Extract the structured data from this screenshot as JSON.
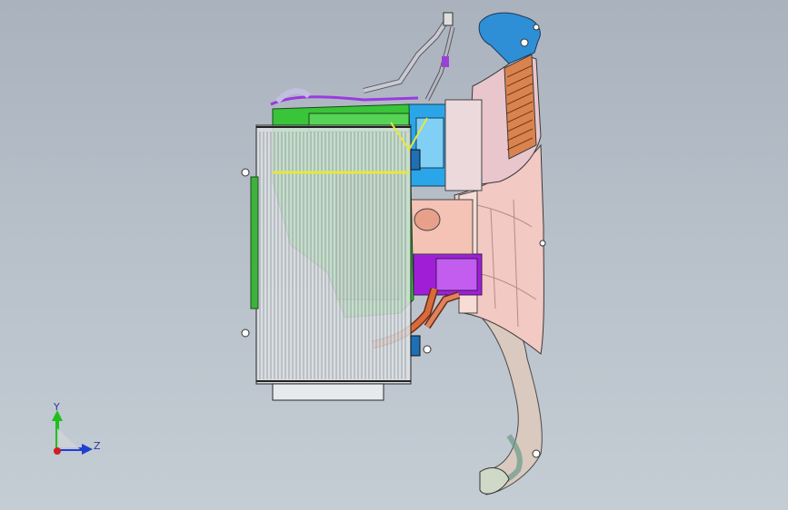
{
  "viewport": {
    "background_top": "#a9b2bd",
    "background_bottom": "#c4ccd4",
    "model": {
      "condenser_frame_color": "#dfe3e6",
      "condenser_fin_color": "#aab0b6",
      "engine_green": "#39c43a",
      "fan_shroud_pink": "#f2c9c3",
      "duct_pink": "#e9c6cc",
      "air_box_blue": "#2aa6e8",
      "purple_bracket": "#a01fd6",
      "hose_gray": "#b9b9c8",
      "intake_orange": "#d86b3a"
    }
  },
  "triad": {
    "y_label": "Y",
    "z_label": "Z",
    "y_color": "#1fbf1f",
    "z_color": "#1f3fcf",
    "x_color": "#d01f1f",
    "origin_color": "#e8e8e8"
  }
}
